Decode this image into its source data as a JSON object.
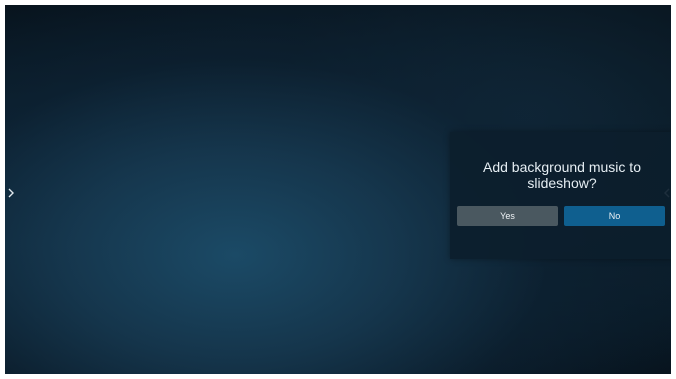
{
  "dialog": {
    "title": "Add background music to slideshow?",
    "yes_label": "Yes",
    "no_label": "No"
  },
  "navigation": {
    "left_arrow_icon": "chevron-right-icon",
    "right_arrow_icon": "chevron-left-icon"
  },
  "colors": {
    "dialog_background": "#0c1e2c",
    "yes_button": "#4a5860",
    "no_button_selected": "#0f5f8f",
    "text": "#e6eef3"
  }
}
